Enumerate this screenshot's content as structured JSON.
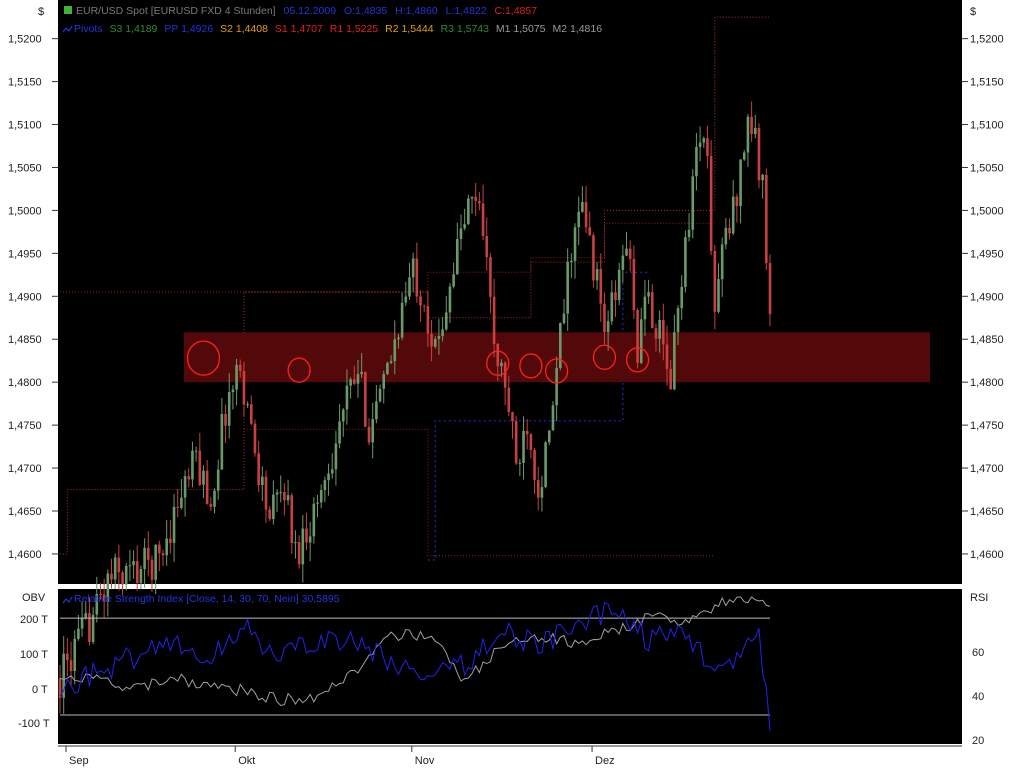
{
  "header": {
    "instrument": "EUR/USD Spot [EURUSD FXD  4 Stunden]",
    "date": "05.12.2009",
    "open": "O:1,4835",
    "high": "H:1,4860",
    "low": "L:1,4822",
    "close": "C:1,4857"
  },
  "pivots": {
    "label": "Pivots",
    "items": [
      {
        "text": "S3 1,4189",
        "color": "#2e8b2e"
      },
      {
        "text": "PP 1,4926",
        "color": "#2233dd"
      },
      {
        "text": "S2 1,4408",
        "color": "#e0a000"
      },
      {
        "text": "S1 1,4707",
        "color": "#e02020"
      },
      {
        "text": "R1 1,5225",
        "color": "#e02020"
      },
      {
        "text": "R2 1,5444",
        "color": "#e0a000"
      },
      {
        "text": "R3 1,5743",
        "color": "#2e8b2e"
      },
      {
        "text": "M1 1,5075",
        "color": "#555555"
      },
      {
        "text": "M2 1,4816",
        "color": "#555555"
      }
    ]
  },
  "indicator": {
    "left_label": "OBV",
    "right_label": "RSI",
    "rsi_legend": "Relative Strength Index [Close, 14, 30, 70, Nein] 30,5895",
    "obv_ticks": [
      "200 T",
      "100 T",
      "0 T",
      "-100 T"
    ],
    "rsi_ticks": [
      "60",
      "40",
      "20"
    ]
  },
  "axes": {
    "price_symbol": "$",
    "x_labels": [
      "Sep",
      "Okt",
      "Nov",
      "Dez"
    ]
  },
  "colors": {
    "background": "#000000",
    "bull": "#6a9a6a",
    "bear": "#c84040",
    "zone": "#5a0a0a",
    "rsi": "#2222ee",
    "obv": "#a0a0a0",
    "pivot_red": "#b03030",
    "pivot_blue": "#2233dd",
    "marker": "#ff2020"
  },
  "chart_data": {
    "type": "candlestick",
    "title": "EUR/USD Spot [EURUSD FXD 4 Stunden]",
    "y_unit": "$",
    "ylim": [
      1.4565,
      1.5245
    ],
    "y_ticks": [
      1.46,
      1.465,
      1.47,
      1.475,
      1.48,
      1.485,
      1.49,
      1.495,
      1.5,
      1.505,
      1.51,
      1.515,
      1.52
    ],
    "x_tick_labels": [
      "Sep",
      "Okt",
      "Nov",
      "Dez"
    ],
    "price_path": [
      [
        0,
        1.4455
      ],
      [
        8,
        1.452
      ],
      [
        14,
        1.4575
      ],
      [
        20,
        1.458
      ],
      [
        27,
        1.4595
      ],
      [
        32,
        1.466
      ],
      [
        37,
        1.471
      ],
      [
        41,
        1.466
      ],
      [
        45,
        1.477
      ],
      [
        49,
        1.482
      ],
      [
        53,
        1.472
      ],
      [
        57,
        1.464
      ],
      [
        61,
        1.468
      ],
      [
        64,
        1.46
      ],
      [
        70,
        1.466
      ],
      [
        74,
        1.472
      ],
      [
        78,
        1.478
      ],
      [
        81,
        1.481
      ],
      [
        84,
        1.475
      ],
      [
        88,
        1.479
      ],
      [
        92,
        1.487
      ],
      [
        96,
        1.493
      ],
      [
        99,
        1.49
      ],
      [
        102,
        1.483
      ],
      [
        106,
        1.492
      ],
      [
        110,
        1.499
      ],
      [
        113,
        1.502
      ],
      [
        116,
        1.496
      ],
      [
        118,
        1.483
      ],
      [
        121,
        1.48
      ],
      [
        124,
        1.47
      ],
      [
        127,
        1.476
      ],
      [
        130,
        1.468
      ],
      [
        133,
        1.473
      ],
      [
        136,
        1.485
      ],
      [
        139,
        1.496
      ],
      [
        142,
        1.5
      ],
      [
        145,
        1.494
      ],
      [
        148,
        1.486
      ],
      [
        151,
        1.49
      ],
      [
        154,
        1.497
      ],
      [
        157,
        1.484
      ],
      [
        160,
        1.49
      ],
      [
        163,
        1.485
      ],
      [
        166,
        1.48
      ],
      [
        169,
        1.493
      ],
      [
        172,
        1.503
      ],
      [
        174,
        1.51
      ],
      [
        176,
        1.505
      ],
      [
        178,
        1.488
      ],
      [
        180,
        1.495
      ],
      [
        183,
        1.5
      ],
      [
        185,
        1.505
      ],
      [
        187,
        1.511
      ],
      [
        189,
        1.508
      ],
      [
        191,
        1.502
      ],
      [
        193,
        1.49
      ]
    ],
    "x_total": 193,
    "support_zone": {
      "from": 1.48,
      "to": 1.4858
    },
    "pivot_levels": {
      "S3": 1.4189,
      "PP": 1.4926,
      "S2": 1.4408,
      "S1": 1.4707,
      "R1": 1.5225,
      "R2": 1.5444,
      "R3": 1.5743,
      "M1": 1.5075,
      "M2": 1.4816
    },
    "pivot_steps_red": [
      [
        0,
        1.46
      ],
      [
        2,
        1.4675
      ],
      [
        50,
        1.4905
      ],
      [
        100,
        1.4875
      ],
      [
        128,
        1.494
      ],
      [
        148,
        1.5
      ],
      [
        178,
        1.5225
      ],
      [
        193,
        1.5225
      ]
    ],
    "pivot_steps_blue": [
      [
        100,
        1.4593
      ],
      [
        102,
        1.4755
      ],
      [
        128,
        1.4755
      ],
      [
        148,
        1.4755
      ],
      [
        150,
        1.4755
      ],
      [
        153,
        1.4928
      ],
      [
        160,
        1.4928
      ]
    ],
    "pivot_steps_m2": [
      [
        0,
        1.4905
      ],
      [
        50,
        1.4905
      ],
      [
        100,
        1.4928
      ],
      [
        128,
        1.4945
      ],
      [
        148,
        1.4985
      ],
      [
        178,
        1.4985
      ]
    ],
    "pivot_steps_low": [
      [
        2,
        1.4675
      ],
      [
        50,
        1.4745
      ],
      [
        100,
        1.4598
      ],
      [
        128,
        1.4598
      ],
      [
        148,
        1.4598
      ],
      [
        178,
        1.4598
      ]
    ],
    "marker_circles": [
      {
        "x": 39,
        "y": 1.4828
      },
      {
        "x": 65,
        "y": 1.4814
      },
      {
        "x": 119,
        "y": 1.4822
      },
      {
        "x": 128,
        "y": 1.4819
      },
      {
        "x": 135,
        "y": 1.4813
      },
      {
        "x": 148,
        "y": 1.4829
      },
      {
        "x": 157,
        "y": 1.4826
      }
    ],
    "obv_path": [
      [
        0,
        0
      ],
      [
        10,
        40
      ],
      [
        20,
        80
      ],
      [
        30,
        120
      ],
      [
        40,
        60
      ],
      [
        50,
        160
      ],
      [
        60,
        70
      ],
      [
        70,
        120
      ],
      [
        80,
        110
      ],
      [
        90,
        70
      ],
      [
        100,
        20
      ],
      [
        110,
        60
      ],
      [
        120,
        140
      ],
      [
        130,
        110
      ],
      [
        140,
        140
      ],
      [
        150,
        200
      ],
      [
        160,
        120
      ],
      [
        170,
        130
      ],
      [
        180,
        40
      ],
      [
        190,
        130
      ],
      [
        193,
        -100
      ]
    ],
    "obv_ylim": [
      -130,
      240
    ],
    "rsi_path": [
      [
        0,
        45
      ],
      [
        10,
        45
      ],
      [
        20,
        40
      ],
      [
        30,
        46
      ],
      [
        40,
        42
      ],
      [
        50,
        40
      ],
      [
        60,
        36
      ],
      [
        70,
        38
      ],
      [
        80,
        48
      ],
      [
        90,
        62
      ],
      [
        100,
        64
      ],
      [
        110,
        44
      ],
      [
        120,
        58
      ],
      [
        130,
        62
      ],
      [
        140,
        60
      ],
      [
        150,
        64
      ],
      [
        160,
        70
      ],
      [
        170,
        69
      ],
      [
        180,
        76
      ],
      [
        190,
        78
      ],
      [
        193,
        74
      ]
    ],
    "rsi_ylim": [
      18,
      82
    ],
    "rsi_guides": [
      30,
      70
    ]
  }
}
